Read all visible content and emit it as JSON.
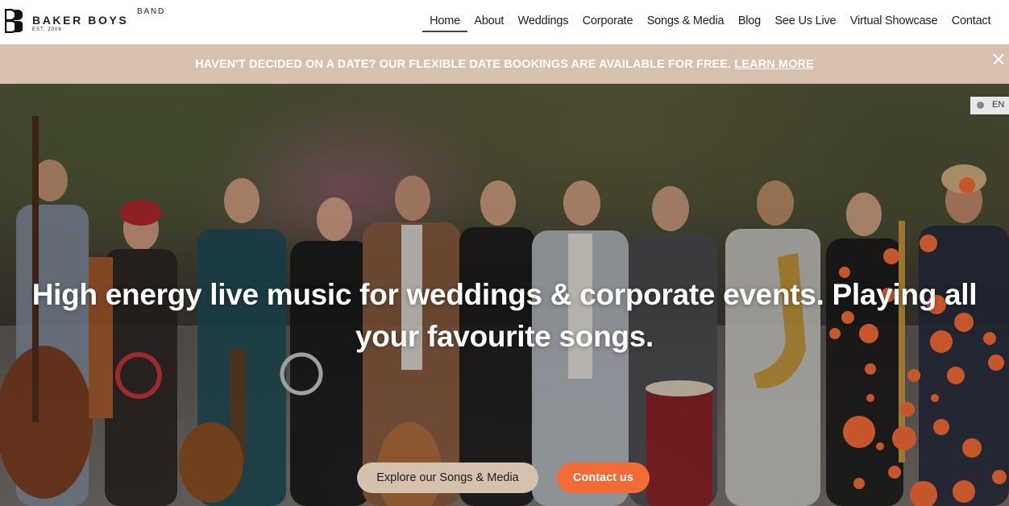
{
  "logo": {
    "name": "BAKER BOYS",
    "band": "BAND",
    "est": "EST. 2006"
  },
  "nav": {
    "items": [
      {
        "label": "Home",
        "active": true
      },
      {
        "label": "About"
      },
      {
        "label": "Weddings"
      },
      {
        "label": "Corporate"
      },
      {
        "label": "Songs & Media"
      },
      {
        "label": "Blog"
      },
      {
        "label": "See Us Live"
      },
      {
        "label": "Virtual Showcase"
      },
      {
        "label": "Contact"
      }
    ]
  },
  "banner": {
    "text": "HAVEN'T DECIDED ON A DATE? OUR FLEXIBLE DATE BOOKINGS ARE AVAILABLE FOR FREE.",
    "link": "LEARN MORE",
    "close_icon": "close-icon"
  },
  "language": {
    "code": "EN",
    "icon": "globe-icon"
  },
  "hero": {
    "headline_line1": "High energy live music for weddings & corporate events. Playing all",
    "headline_line2": "your favourite songs.",
    "primary_button": "Explore our Songs & Media",
    "secondary_button": "Contact us"
  },
  "colors": {
    "banner_bg": "#d6c0ae",
    "accent_orange": "#f26a36",
    "text_dark": "#1e1e1e"
  }
}
